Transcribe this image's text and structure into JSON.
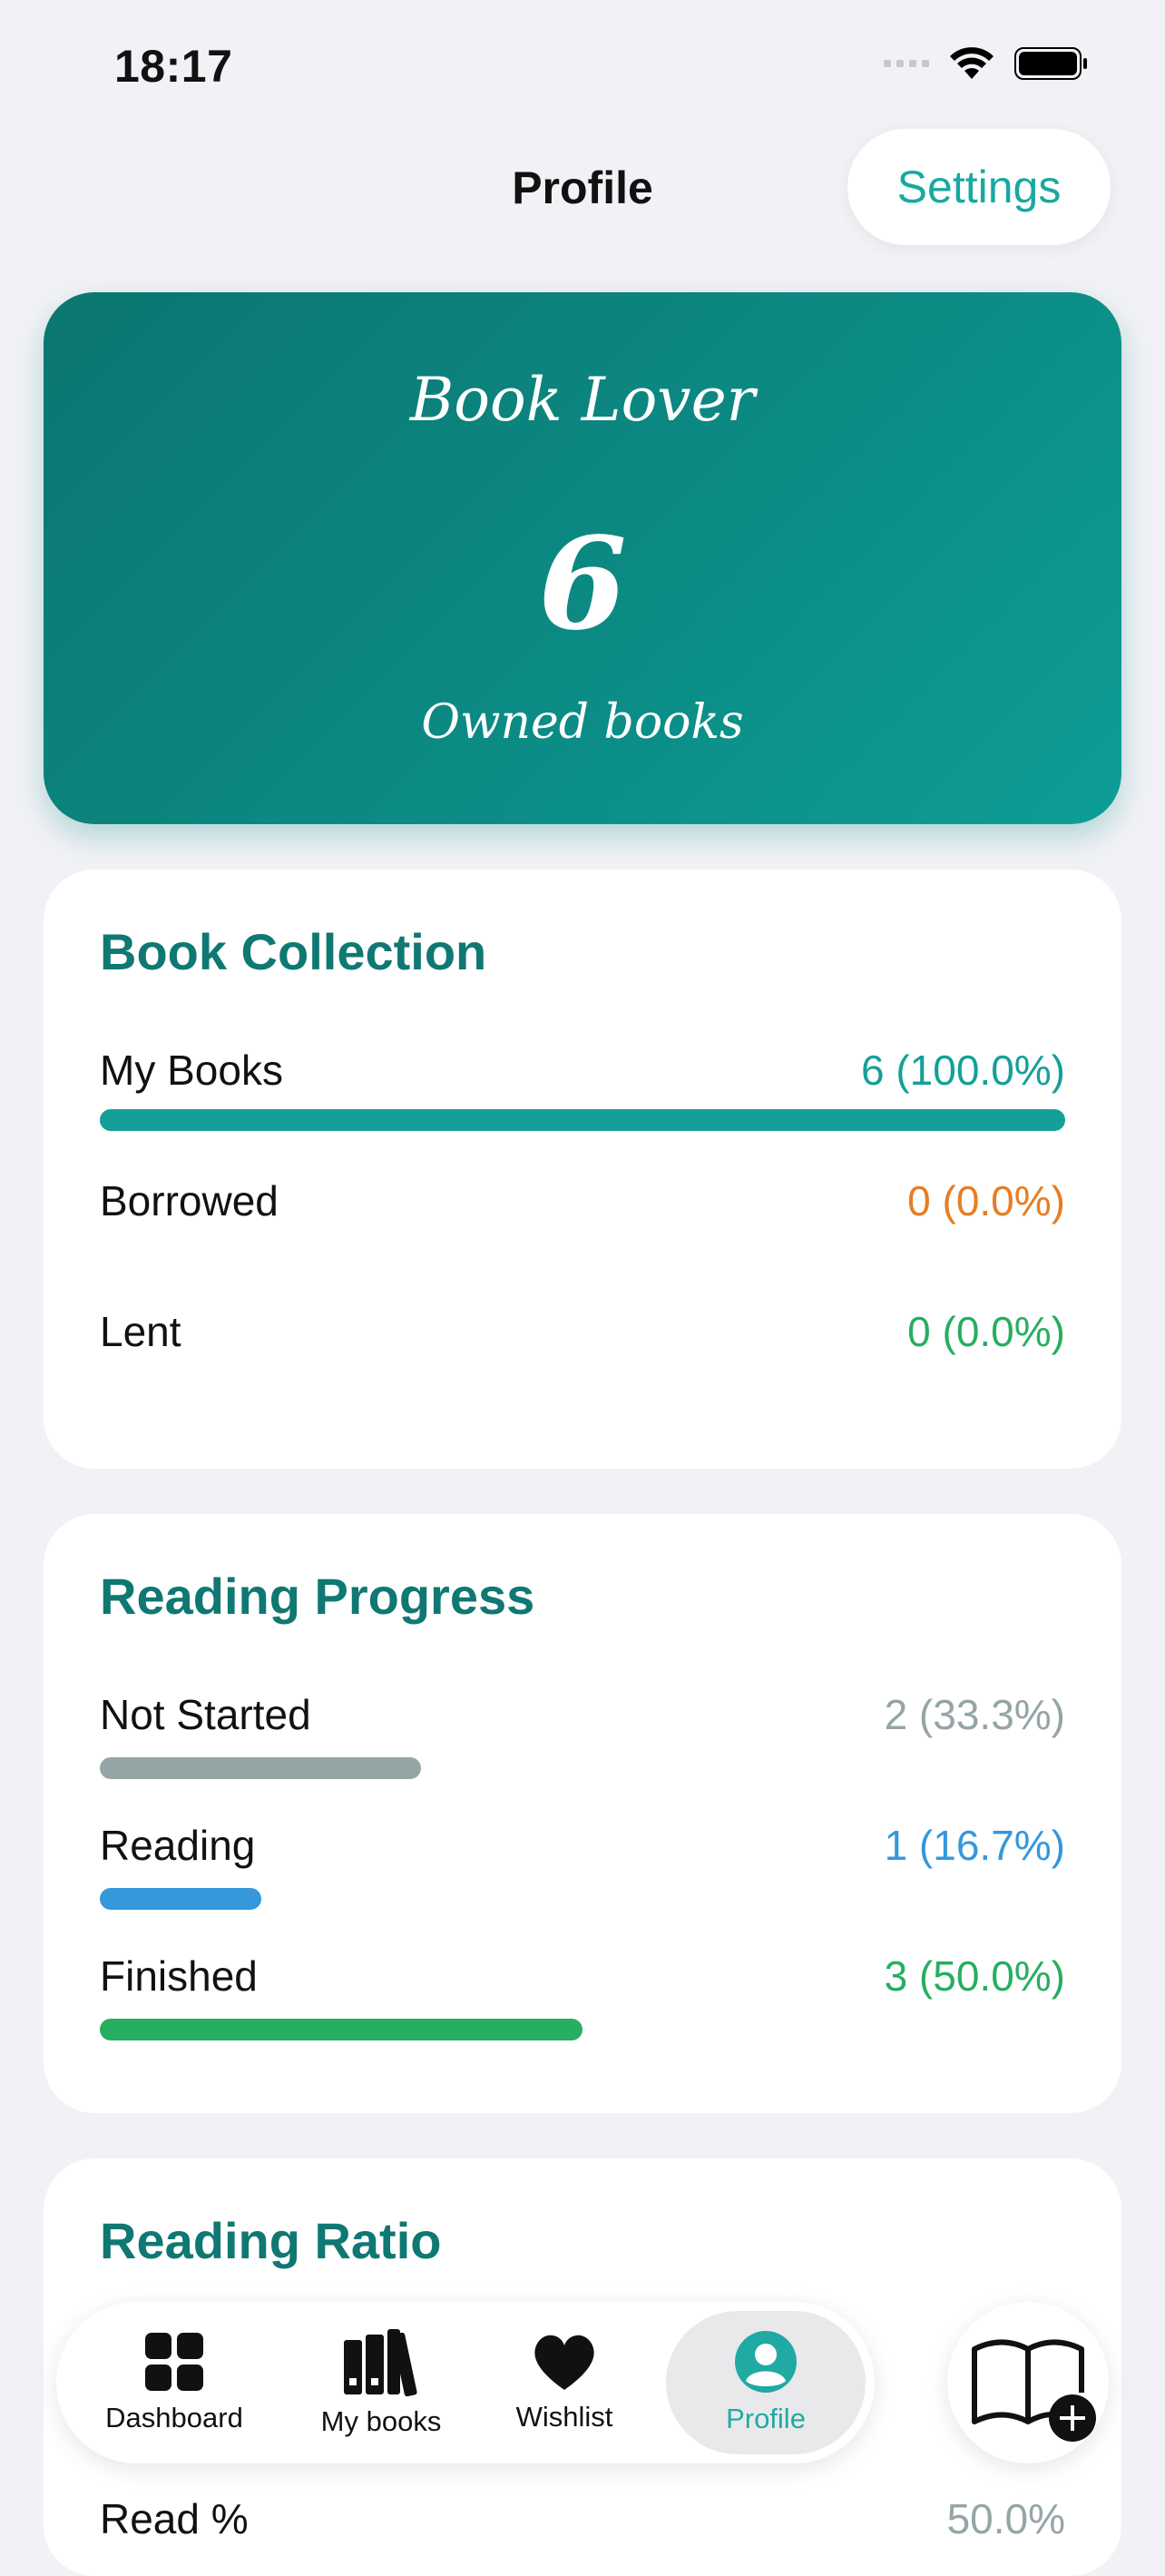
{
  "status_bar": {
    "time": "18:17"
  },
  "header": {
    "title": "Profile",
    "settings_label": "Settings"
  },
  "hero": {
    "title": "Book Lover",
    "count": "6",
    "subtitle": "Owned books"
  },
  "collection": {
    "title": "Book Collection",
    "rows": [
      {
        "label": "My Books",
        "value": "6 (100.0%)",
        "color": "#14a098",
        "fraction": 1.0
      },
      {
        "label": "Borrowed",
        "value": "0 (0.0%)",
        "color": "#e67e22",
        "fraction": 0.0
      },
      {
        "label": "Lent",
        "value": "0 (0.0%)",
        "color": "#27ae60",
        "fraction": 0.0
      }
    ]
  },
  "progress": {
    "title": "Reading Progress",
    "rows": [
      {
        "label": "Not Started",
        "value": "2 (33.3%)",
        "color": "#95a5a6",
        "fraction": 0.333
      },
      {
        "label": "Reading",
        "value": "1 (16.7%)",
        "color": "#3498db",
        "fraction": 0.167
      },
      {
        "label": "Finished",
        "value": "3 (50.0%)",
        "color": "#27ae60",
        "fraction": 0.5
      }
    ]
  },
  "ratio": {
    "title": "Reading Ratio",
    "row_label": "Read %",
    "row_value": "50.0%"
  },
  "tabs": [
    {
      "label": "Dashboard",
      "icon": "dashboard-icon"
    },
    {
      "label": "My books",
      "icon": "books-icon"
    },
    {
      "label": "Wishlist",
      "icon": "heart-icon"
    },
    {
      "label": "Profile",
      "icon": "profile-icon",
      "active": true
    }
  ],
  "add_book": {
    "icon": "add-book-icon"
  }
}
